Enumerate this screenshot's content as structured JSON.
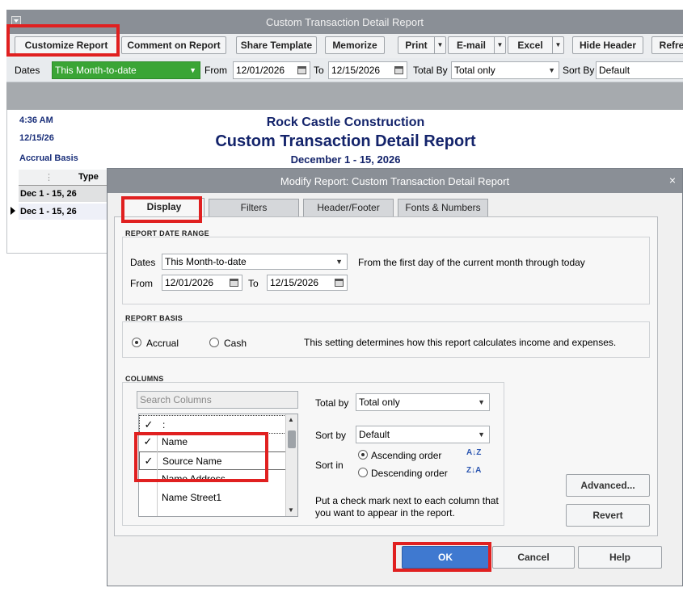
{
  "report_window": {
    "title": "Custom Transaction Detail Report",
    "toolbar": {
      "customize": "Customize Report",
      "comment": "Comment on Report",
      "share": "Share Template",
      "memorize": "Memorize",
      "print": "Print",
      "email": "E-mail",
      "excel": "Excel",
      "hide_header": "Hide Header",
      "refresh": "Refre"
    },
    "filters": {
      "dates_label": "Dates",
      "dates_value": "This Month-to-date",
      "from_label": "From",
      "from_value": "12/01/2026",
      "to_label": "To",
      "to_value": "12/15/2026",
      "total_by_label": "Total By",
      "total_by_value": "Total only",
      "sort_by_label": "Sort By",
      "sort_by_value": "Default"
    },
    "report": {
      "time": "4:36 AM",
      "date": "12/15/26",
      "basis": "Accrual Basis",
      "company": "Rock Castle Construction",
      "title": "Custom Transaction Detail Report",
      "range": "December 1 - 15, 2026",
      "col_type": "Type",
      "rows": [
        "Dec 1 - 15, 26",
        "Dec 1 - 15, 26"
      ]
    }
  },
  "dialog": {
    "title": "Modify Report: Custom Transaction Detail Report",
    "tabs": [
      "Display",
      "Filters",
      "Header/Footer",
      "Fonts & Numbers"
    ],
    "date_range": {
      "heading": "REPORT DATE RANGE",
      "dates_label": "Dates",
      "dates_value": "This Month-to-date",
      "description": "From the first day of the current month through today",
      "from_label": "From",
      "from_value": "12/01/2026",
      "to_label": "To",
      "to_value": "12/15/2026"
    },
    "basis": {
      "heading": "REPORT BASIS",
      "accrual": "Accrual",
      "cash": "Cash",
      "selected": "Accrual",
      "description": "This setting determines how this report calculates income and expenses."
    },
    "columns": {
      "heading": "COLUMNS",
      "search_placeholder": "Search Columns",
      "items": [
        {
          "check": "✓",
          "name": ":"
        },
        {
          "check": "✓",
          "name": "Name"
        },
        {
          "check": "✓",
          "name": "Source Name"
        },
        {
          "check": "",
          "name": "Name Address"
        },
        {
          "check": "",
          "name": "Name Street1"
        }
      ],
      "total_by_label": "Total by",
      "total_by_value": "Total only",
      "sort_by_label": "Sort by",
      "sort_by_value": "Default",
      "sort_in_label": "Sort in",
      "ascending": "Ascending order",
      "descending": "Descending order",
      "hint": "Put a check mark next to each column that you want to appear in the report."
    },
    "buttons": {
      "advanced": "Advanced...",
      "revert": "Revert",
      "ok": "OK",
      "cancel": "Cancel",
      "help": "Help"
    },
    "close_glyph": "×"
  },
  "colors": {
    "titlebar": "#8a8f96",
    "report_blue": "#14246b",
    "dates_green": "#3aa535",
    "ok_blue": "#3f79d0",
    "highlight_red": "#e02020"
  }
}
